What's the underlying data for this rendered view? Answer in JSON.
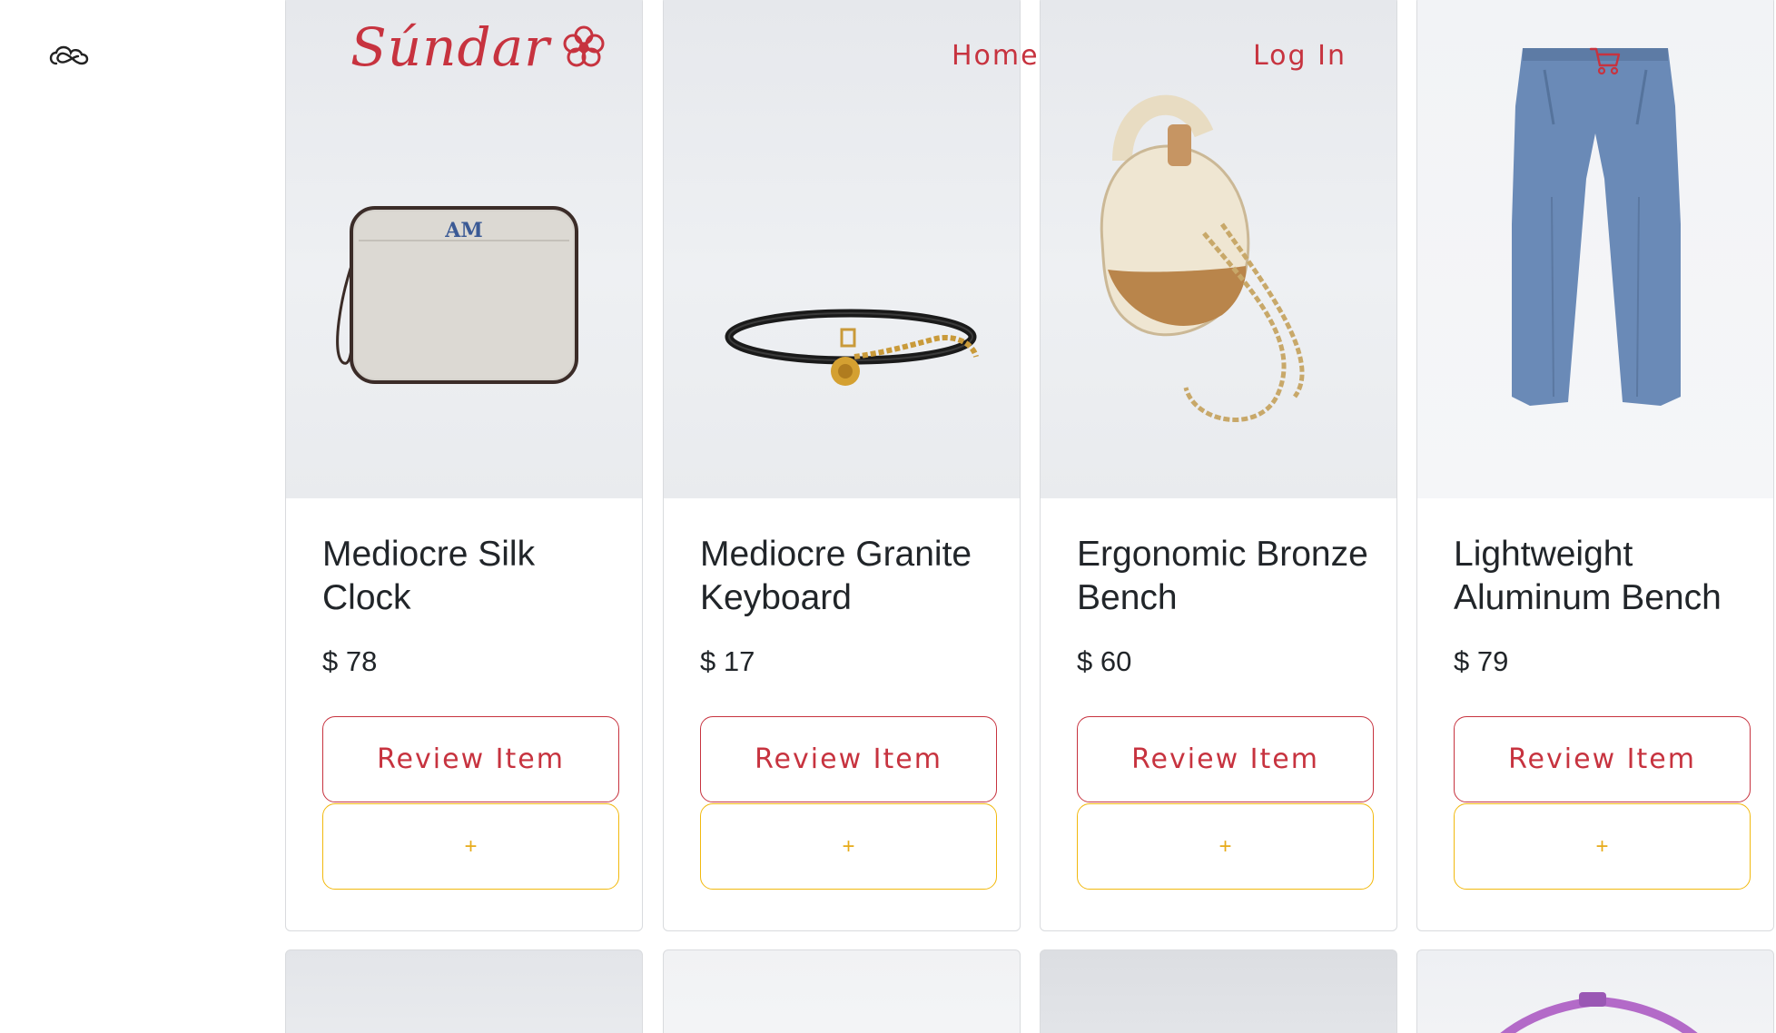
{
  "header": {
    "brand": "Súndar",
    "nav": {
      "home": "Home",
      "login": "Log In"
    }
  },
  "products": [
    {
      "title": "Mediocre Silk Clock",
      "price": "$ 78",
      "review_label": "Review Item",
      "add_label": "+",
      "image": "beige-pouch-monogram-AM",
      "monogram": "AM"
    },
    {
      "title": "Mediocre Granite Keyboard",
      "price": "$ 17",
      "review_label": "Review Item",
      "add_label": "+",
      "image": "black-belt-gold-chain"
    },
    {
      "title": "Ergonomic Bronze Bench",
      "price": "$ 60",
      "review_label": "Review Item",
      "add_label": "+",
      "image": "wicker-bag-gold-chain"
    },
    {
      "title": "Lightweight Aluminum Bench",
      "price": "$ 79",
      "review_label": "Review Item",
      "add_label": "+",
      "image": "blue-trousers"
    }
  ],
  "colors": {
    "accent": "#c7333f",
    "secondary": "#f2b90e",
    "text": "#212529",
    "border": "#d9dbde"
  }
}
